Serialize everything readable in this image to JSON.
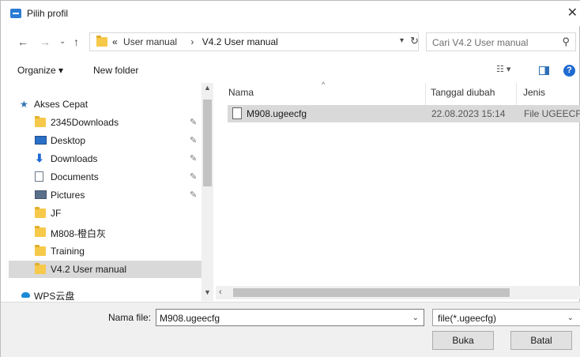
{
  "window": {
    "title": "Pilih profil",
    "close_glyph": "✕"
  },
  "address": {
    "overflow": "«",
    "crumbs": [
      "User manual",
      "V4.2 User manual"
    ],
    "separator": "›",
    "search_placeholder": "Cari V4.2 User manual"
  },
  "toolbar": {
    "organize_label": "Organize ▾",
    "new_folder_label": "New folder"
  },
  "nav": {
    "items": [
      {
        "label": "Akses Cepat",
        "icon": "star-icon"
      },
      {
        "label": "2345Downloads",
        "icon": "folder-icon",
        "pinned": true
      },
      {
        "label": "Desktop",
        "icon": "desktop-icon",
        "pinned": true
      },
      {
        "label": "Downloads",
        "icon": "download-arrow-icon",
        "pinned": true
      },
      {
        "label": "Documents",
        "icon": "document-icon",
        "pinned": true
      },
      {
        "label": "Pictures",
        "icon": "pictures-icon",
        "pinned": true
      },
      {
        "label": "JF",
        "icon": "folder-icon"
      },
      {
        "label": "M808-橙白灰",
        "icon": "folder-icon"
      },
      {
        "label": "Training",
        "icon": "folder-icon"
      },
      {
        "label": "V4.2 User manual",
        "icon": "folder-icon",
        "selected": true
      },
      {
        "label": "WPS云盘",
        "icon": "cloud-icon"
      }
    ]
  },
  "files": {
    "columns": {
      "name": "Nama",
      "date": "Tanggal diubah",
      "type": "Jenis"
    },
    "rows": [
      {
        "name": "M908.ugeecfg",
        "date": "22.08.2023 15:14",
        "type": "File UGEECFG"
      }
    ]
  },
  "bottom": {
    "filename_label": "Nama file:",
    "filename_value": "M908.ugeecfg",
    "filetype_value": "file(*.ugeecfg)",
    "open_label": "Buka",
    "cancel_label": "Batal"
  },
  "colors": {
    "accent": "#1f6ad0",
    "selection": "#d9d9d9",
    "folder": "#f6c94a"
  }
}
